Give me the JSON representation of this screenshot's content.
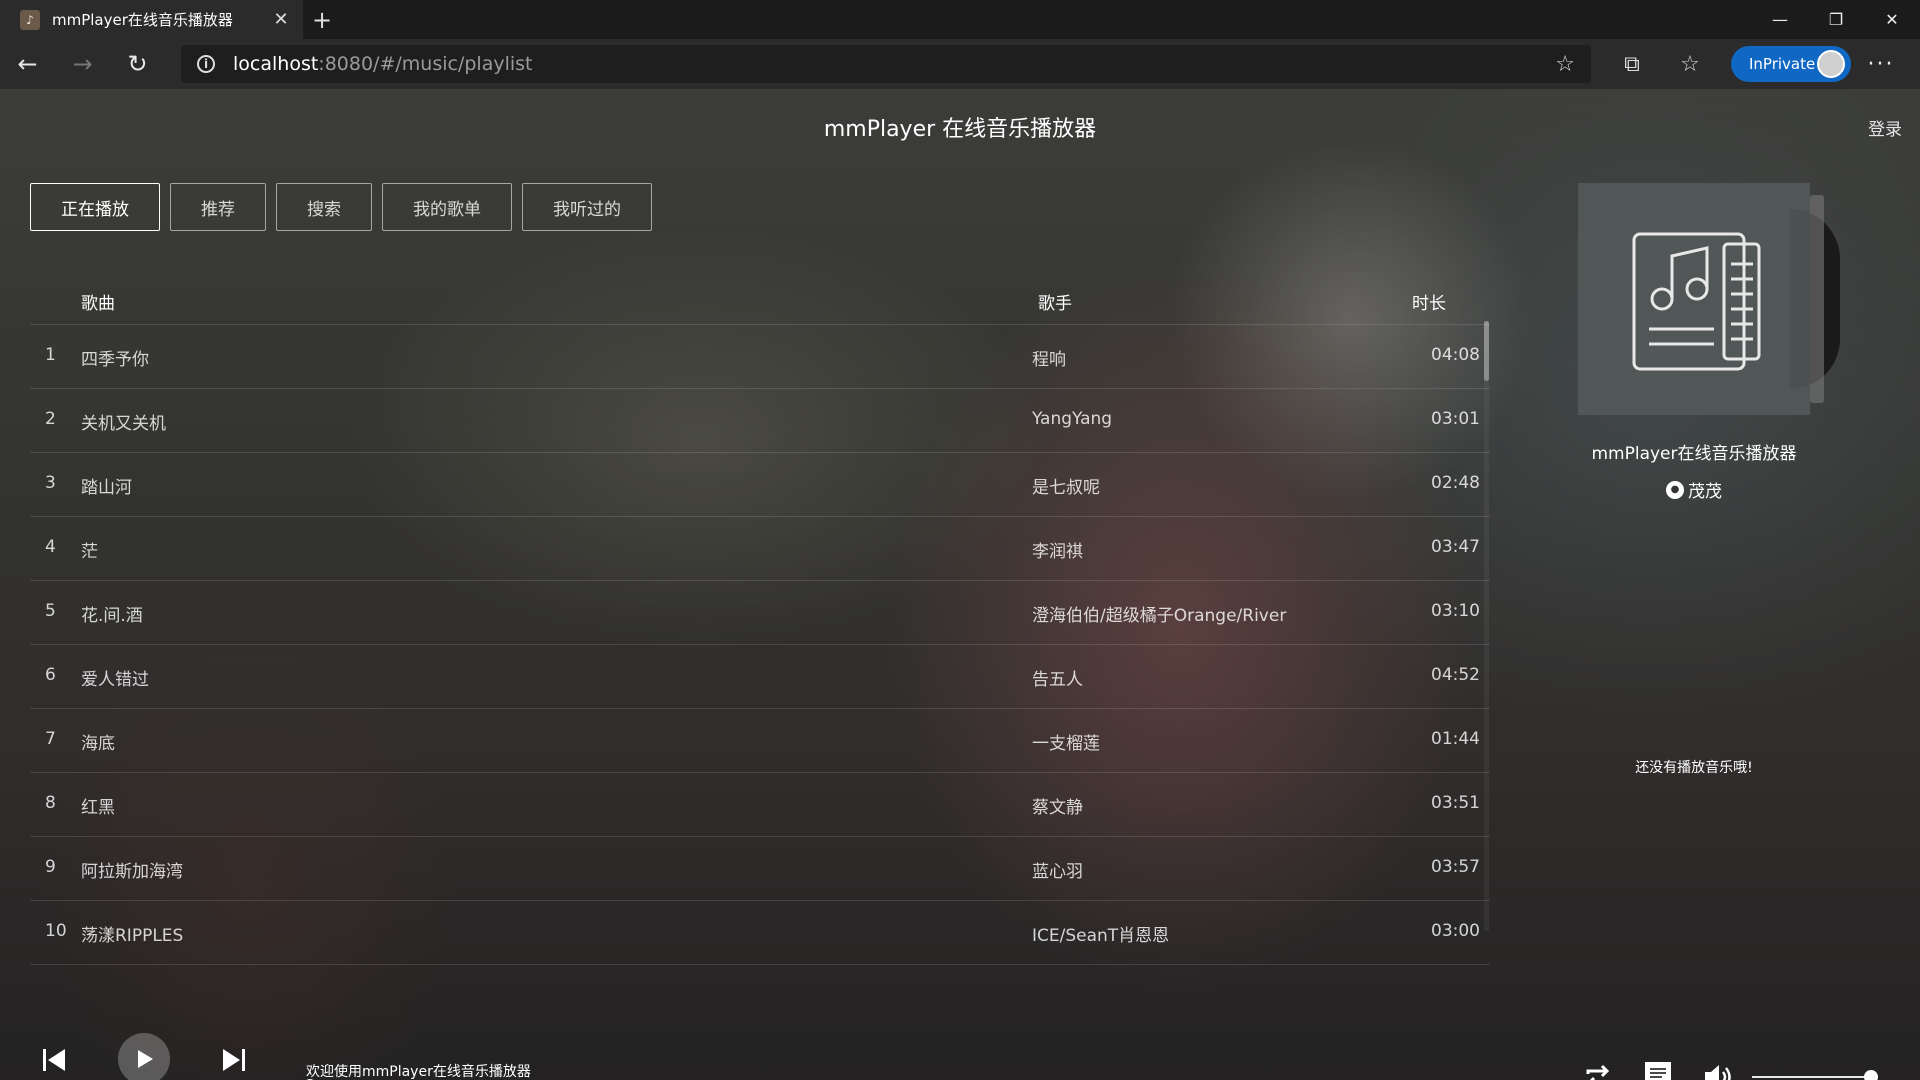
{
  "browser": {
    "tab_title": "mmPlayer在线音乐播放器",
    "url_host": "localhost",
    "url_path": ":8080/#/music/playlist",
    "inprivate_label": "InPrivate"
  },
  "app": {
    "title": "mmPlayer 在线音乐播放器",
    "login": "登录",
    "tabs": [
      "正在播放",
      "推荐",
      "搜索",
      "我的歌单",
      "我听过的"
    ],
    "columns": {
      "song": "歌曲",
      "singer": "歌手",
      "duration": "时长"
    },
    "songs": [
      {
        "idx": "1",
        "name": "四季予你",
        "singer": "程响",
        "duration": "04:08"
      },
      {
        "idx": "2",
        "name": "关机又关机",
        "singer": "YangYang",
        "duration": "03:01"
      },
      {
        "idx": "3",
        "name": "踏山河",
        "singer": "是七叔呢",
        "duration": "02:48"
      },
      {
        "idx": "4",
        "name": "茫",
        "singer": "李润祺",
        "duration": "03:47"
      },
      {
        "idx": "5",
        "name": "花.间.酒",
        "singer": "澄海伯伯/超级橘子Orange/River",
        "duration": "03:10"
      },
      {
        "idx": "6",
        "name": "爱人错过",
        "singer": "告五人",
        "duration": "04:52"
      },
      {
        "idx": "7",
        "name": "海底",
        "singer": "一支榴莲",
        "duration": "01:44"
      },
      {
        "idx": "8",
        "name": "红黑",
        "singer": "蔡文静",
        "duration": "03:51"
      },
      {
        "idx": "9",
        "name": "阿拉斯加海湾",
        "singer": "蓝心羽",
        "duration": "03:57"
      },
      {
        "idx": "10",
        "name": "荡漾RIPPLES",
        "singer": "ICE/SeanT肖恩恩",
        "duration": "03:00"
      }
    ],
    "sidebar": {
      "app_name": "mmPlayer在线音乐播放器",
      "author": "茂茂",
      "no_music": "还没有播放音乐哦!"
    },
    "player": {
      "now_playing_text": "欢迎使用mmPlayer在线音乐播放器",
      "progress": 0,
      "volume": 1.0
    }
  }
}
